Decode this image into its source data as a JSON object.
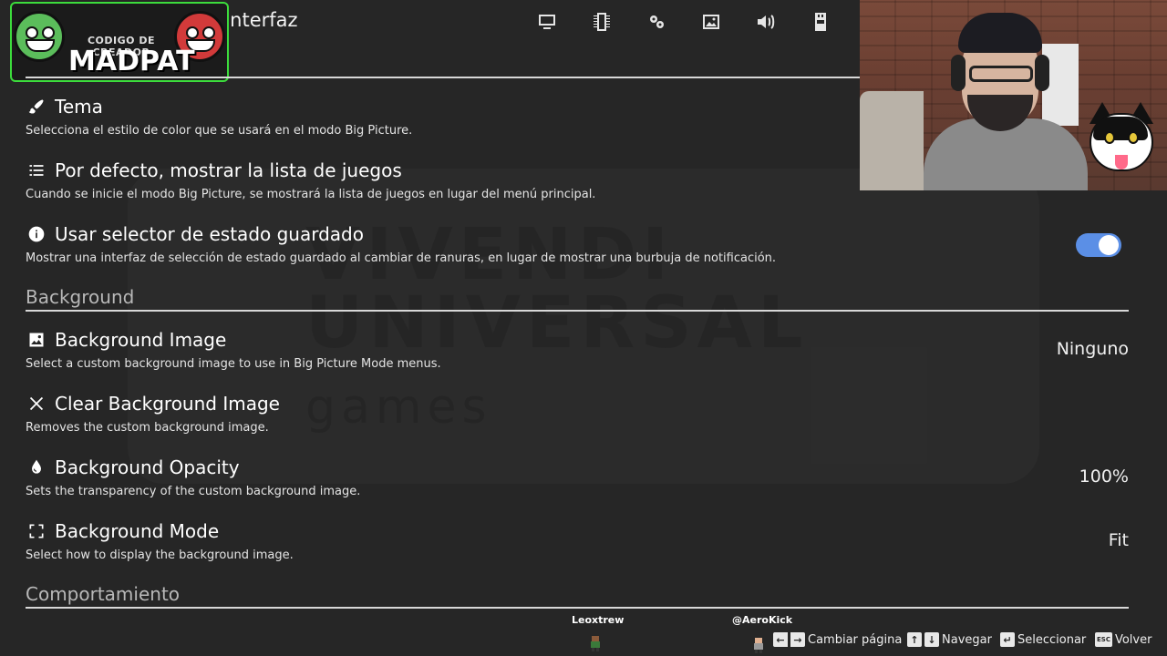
{
  "header": {
    "title": "Configuración de interfaz",
    "category_icons": [
      "monitor-icon",
      "memory-icon",
      "controller-settings-icon",
      "image-icon",
      "volume-icon",
      "memory-card-icon",
      "network-icon"
    ]
  },
  "logo": {
    "subtitle": "CODIGO DE CREADOR",
    "name": "MADPAT"
  },
  "watermark": {
    "line1": "VIVENDI",
    "line2": "UNIVERSAL",
    "line3": "games"
  },
  "settings": [
    {
      "title": "Tema",
      "desc": "Selecciona el estilo de color que se usará en el modo Big Picture.",
      "icon": "paintbrush-icon",
      "value": ""
    },
    {
      "title": "Por defecto, mostrar la lista de juegos",
      "desc": "Cuando se inicie el modo Big Picture, se mostrará la lista de juegos en lugar del menú principal.",
      "icon": "list-icon",
      "value": ""
    },
    {
      "title": "Usar selector de estado guardado",
      "desc": "Mostrar una interfaz de selección de estado guardado al cambiar de ranuras, en lugar de mostrar una burbuja de notificación.",
      "icon": "info-icon",
      "value": "",
      "toggle_on": true
    }
  ],
  "sections": {
    "background": "Background",
    "behavior": "Comportamiento"
  },
  "background_settings": [
    {
      "title": "Background Image",
      "desc": "Select a custom background image to use in Big Picture Mode menus.",
      "icon": "image-icon",
      "value": "Ninguno"
    },
    {
      "title": "Clear Background Image",
      "desc": "Removes the custom background image.",
      "icon": "close-icon",
      "value": ""
    },
    {
      "title": "Background Opacity",
      "desc": "Sets the transparency of the custom background image.",
      "icon": "droplet-icon",
      "value": "100%"
    },
    {
      "title": "Background Mode",
      "desc": "Select how to display the background image.",
      "icon": "fullscreen-icon",
      "value": "Fit"
    }
  ],
  "chat": {
    "user1": "Leoxtrew",
    "user2": "@AeroKick"
  },
  "footer": {
    "change_page": "Cambiar página",
    "navigate": "Navegar",
    "select": "Seleccionar",
    "back": "Volver",
    "esc_key": "ESC"
  },
  "colors": {
    "background": "#262626",
    "toggle_on": "#5b8fe6",
    "logo_border": "#3cdc3c"
  }
}
